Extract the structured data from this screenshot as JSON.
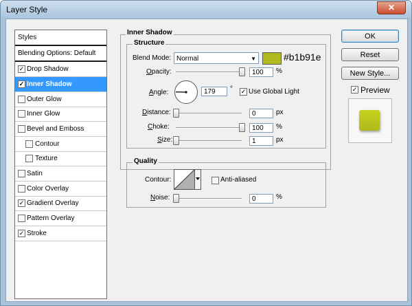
{
  "window": {
    "title": "Layer Style",
    "close_glyph": "✕"
  },
  "styles_list": [
    {
      "label": "Styles",
      "kind": "header"
    },
    {
      "label": "Blending Options: Default",
      "kind": "header"
    },
    {
      "label": "Drop Shadow",
      "checked": true,
      "indent": 0
    },
    {
      "label": "Inner Shadow",
      "checked": true,
      "indent": 0,
      "selected": true
    },
    {
      "label": "Outer Glow",
      "checked": false,
      "indent": 0
    },
    {
      "label": "Inner Glow",
      "checked": false,
      "indent": 0
    },
    {
      "label": "Bevel and Emboss",
      "checked": false,
      "indent": 0
    },
    {
      "label": "Contour",
      "checked": false,
      "indent": 1
    },
    {
      "label": "Texture",
      "checked": false,
      "indent": 1
    },
    {
      "label": "Satin",
      "checked": false,
      "indent": 0
    },
    {
      "label": "Color Overlay",
      "checked": false,
      "indent": 0
    },
    {
      "label": "Gradient Overlay",
      "checked": true,
      "indent": 0
    },
    {
      "label": "Pattern Overlay",
      "checked": false,
      "indent": 0
    },
    {
      "label": "Stroke",
      "checked": true,
      "indent": 0
    }
  ],
  "inner_shadow": {
    "section_title": "Inner Shadow",
    "structure_title": "Structure",
    "blend_mode_label": "Blend Mode:",
    "blend_mode_value": "Normal",
    "color_hex": "#b1b91e",
    "color_label": "#b1b91e",
    "opacity_label": "Opacity:",
    "opacity_value": "100",
    "opacity_level": 1.0,
    "angle_label": "Angle:",
    "angle_value": "179",
    "angle_unit": "°",
    "use_global_light_label": "Use Global Light",
    "use_global_light": true,
    "distance_label": "Distance:",
    "distance_value": "0",
    "distance_level": 0.0,
    "choke_label": "Choke:",
    "choke_value": "100",
    "choke_level": 1.0,
    "size_label": "Size:",
    "size_value": "1",
    "size_level": 0.0,
    "percent_unit": "%",
    "px_unit": "px"
  },
  "quality": {
    "title": "Quality",
    "contour_label": "Contour:",
    "anti_aliased_label": "Anti-aliased",
    "anti_aliased": false,
    "noise_label": "Noise:",
    "noise_value": "0",
    "noise_level": 0.0,
    "percent_unit": "%"
  },
  "buttons": {
    "ok": "OK",
    "reset": "Reset",
    "new_style": "New Style..."
  },
  "preview": {
    "label": "Preview",
    "checked": true,
    "swatch_color": "#c5d21e"
  },
  "icons": {
    "dropdown": "chevron-down-icon",
    "check": "check-icon"
  }
}
